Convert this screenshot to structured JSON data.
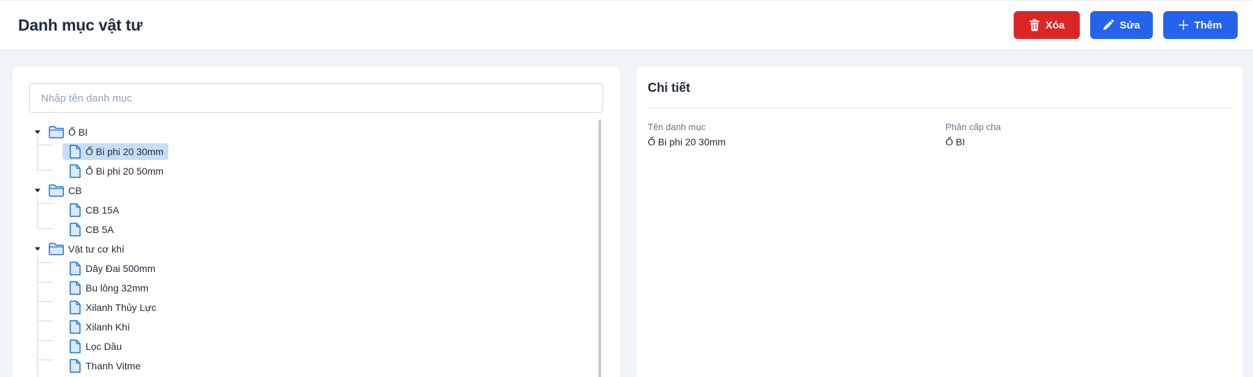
{
  "header": {
    "title": "Danh mục vật tư",
    "buttons": {
      "delete_label": "Xóa",
      "edit_label": "Sửa",
      "add_label": "Thêm"
    }
  },
  "search": {
    "placeholder": "Nhập tên danh mục",
    "value": ""
  },
  "tree": {
    "groups": [
      {
        "label": "Ổ BI",
        "expanded": true,
        "children": [
          {
            "label": "Ổ Bi phi 20 30mm",
            "selected": true
          },
          {
            "label": "Ổ Bi phi 20 50mm",
            "selected": false
          }
        ]
      },
      {
        "label": "CB",
        "expanded": true,
        "children": [
          {
            "label": "CB 15A",
            "selected": false
          },
          {
            "label": "CB 5A",
            "selected": false
          }
        ]
      },
      {
        "label": "Vật tư cơ khí",
        "expanded": true,
        "children": [
          {
            "label": "Dây Đai 500mm",
            "selected": false
          },
          {
            "label": "Bu lông 32mm",
            "selected": false
          },
          {
            "label": "Xilanh Thủy Lực",
            "selected": false
          },
          {
            "label": "Xilanh Khí",
            "selected": false
          },
          {
            "label": "Lọc Dầu",
            "selected": false
          },
          {
            "label": "Thanh Vitme",
            "selected": false
          }
        ]
      }
    ]
  },
  "detail": {
    "title": "Chi tiết",
    "name_label": "Tên danh mục",
    "name_value": "Ổ Bi phi 20 30mm",
    "parent_label": "Phân cấp cha",
    "parent_value": "Ổ BI"
  },
  "icons": {
    "delete": "trash-icon",
    "edit": "pencil-icon",
    "add": "plus-icon",
    "group": "folder-icon",
    "item": "file-icon",
    "toggle": "caret-down-icon"
  },
  "colors": {
    "danger": "#dc2626",
    "primary": "#2563eb",
    "selected": "#c7def7",
    "icon": "#1d6fe0",
    "icon_fill": "#dbe9fb"
  }
}
